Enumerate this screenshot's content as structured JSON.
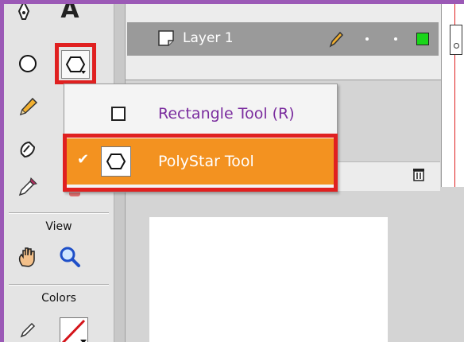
{
  "tools_panel": {
    "text_tool_glyph": "A",
    "view_label": "View",
    "colors_label": "Colors"
  },
  "timeline": {
    "layer_name": "Layer 1"
  },
  "tool_menu": {
    "items": [
      {
        "label": "Rectangle Tool (R)",
        "selected": false
      },
      {
        "label": "PolyStar Tool",
        "selected": true
      }
    ],
    "checkmark": "✔"
  },
  "colors": {
    "highlight_border": "#e02020",
    "selected_item_bg": "#f39220",
    "rect_label_text": "#7a2c9e",
    "frame_border": "#9b59b6"
  }
}
